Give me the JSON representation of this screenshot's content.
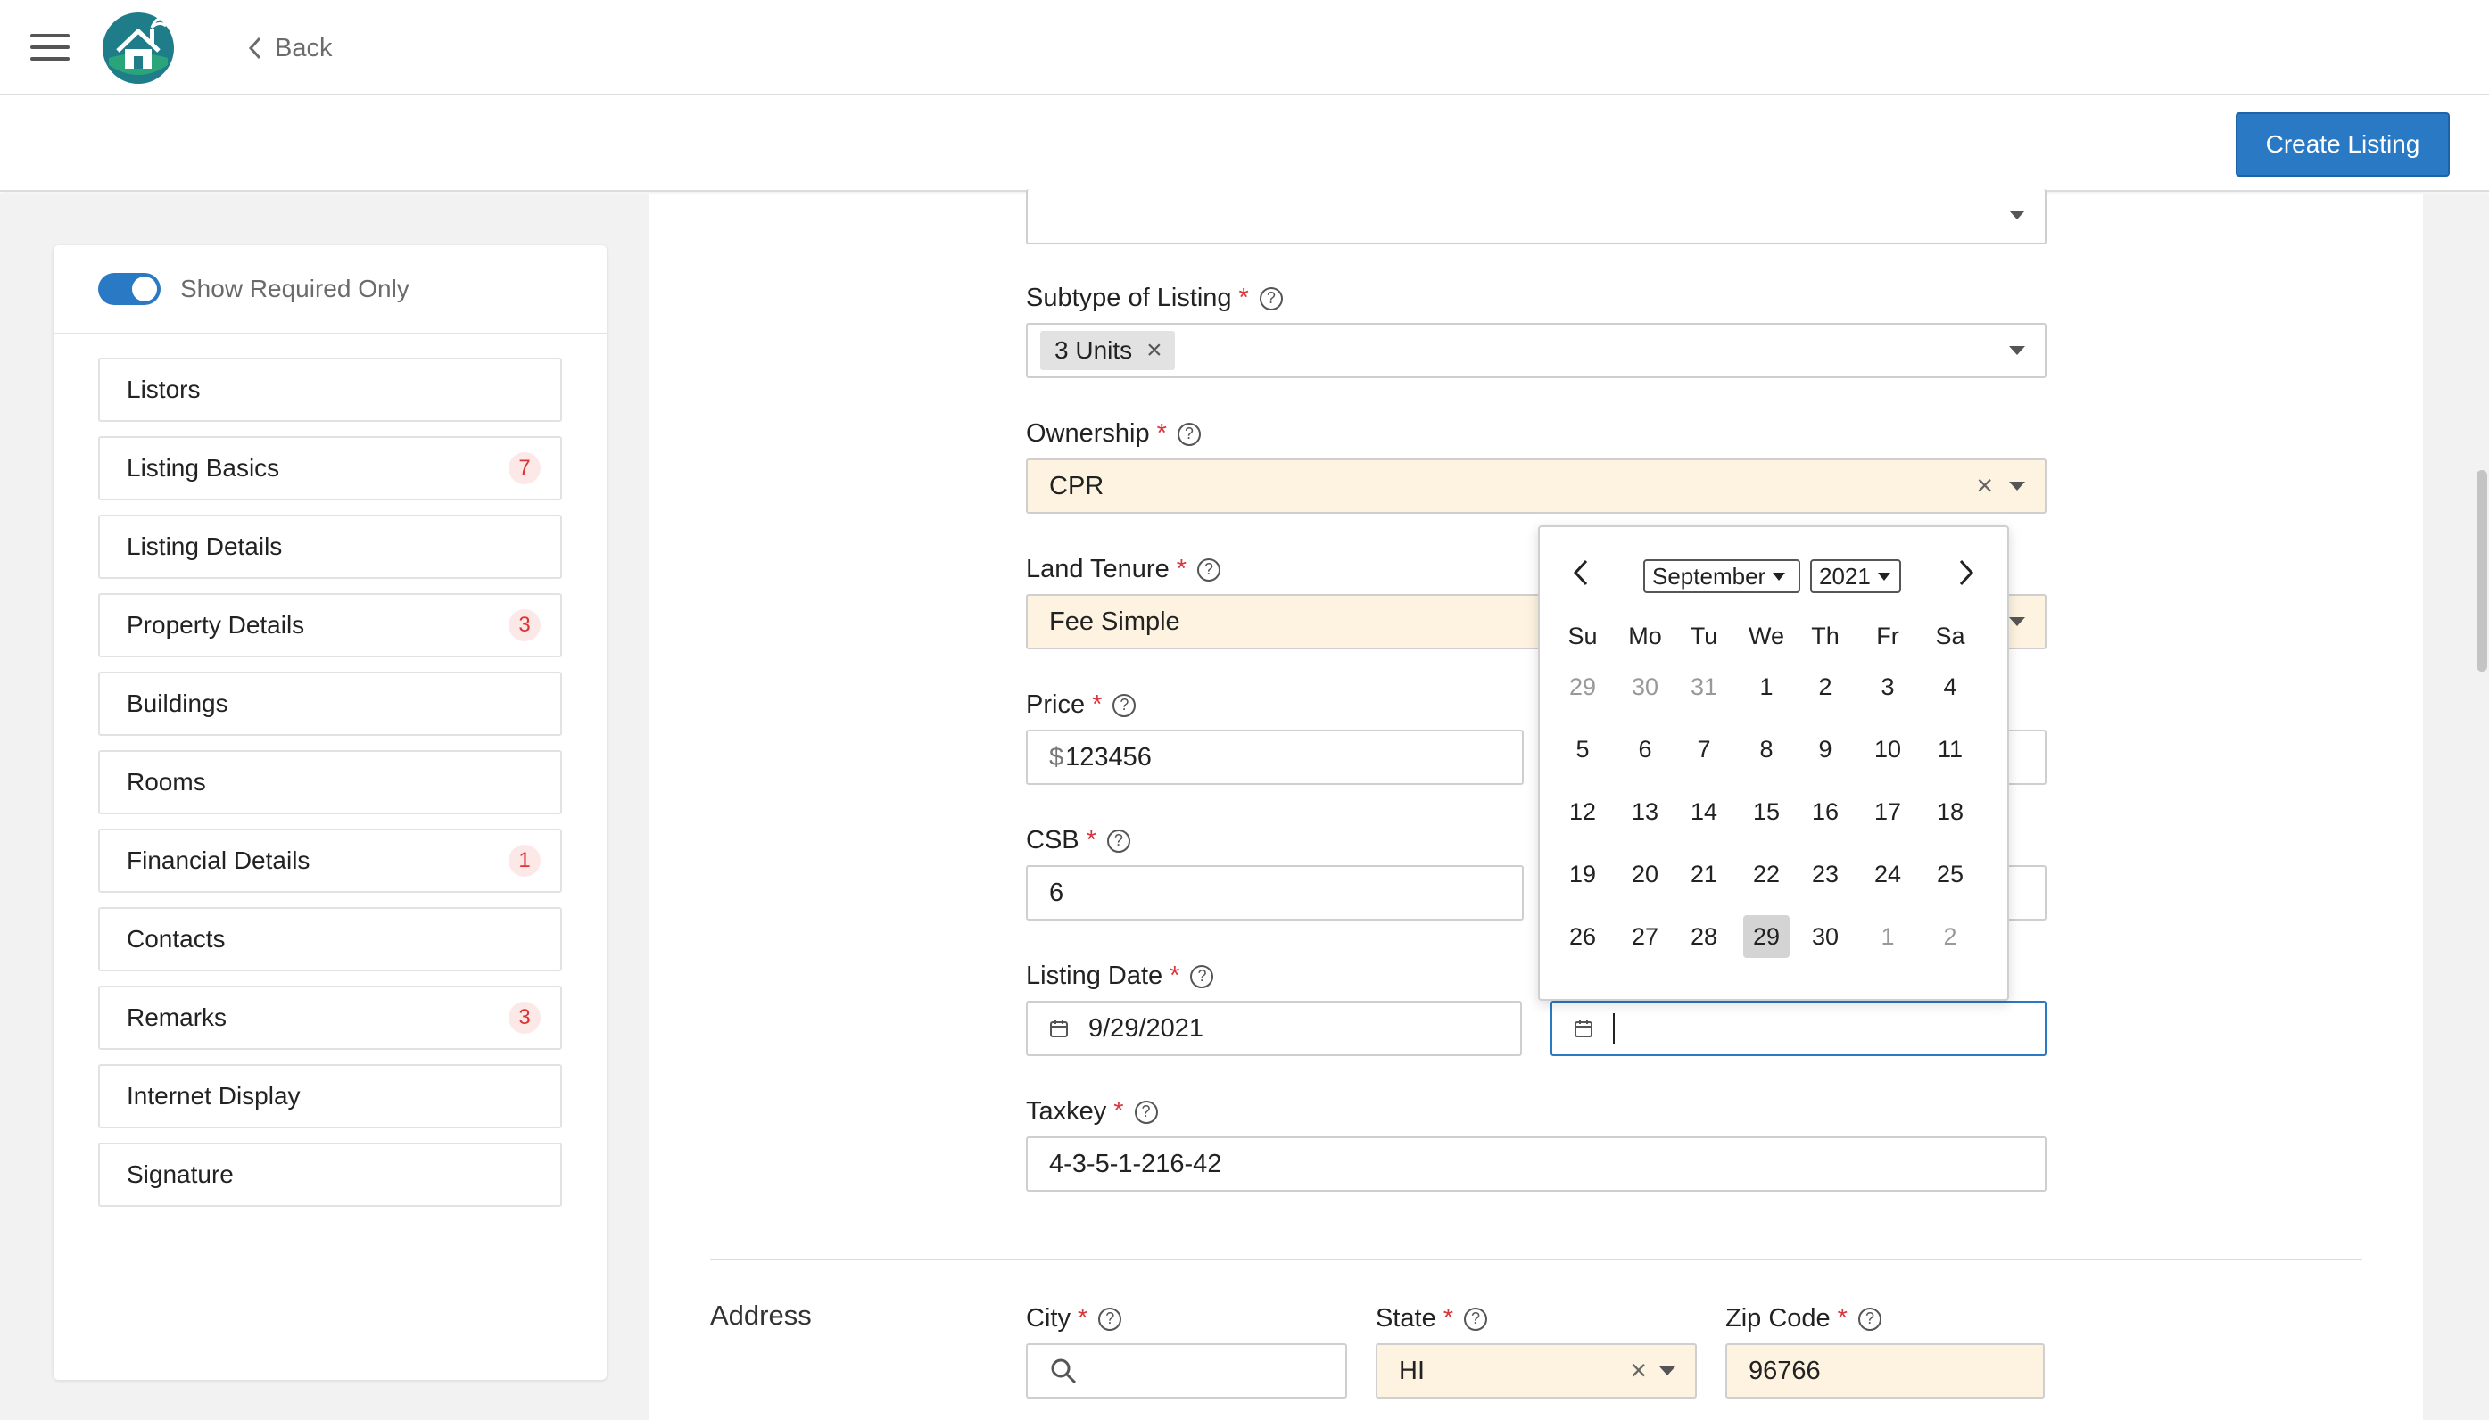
{
  "header": {
    "back_label": "Back"
  },
  "actionbar": {
    "create_label": "Create Listing"
  },
  "sidebar": {
    "toggle_label": "Show Required Only",
    "items": [
      {
        "label": "Listors",
        "badge": ""
      },
      {
        "label": "Listing Basics",
        "badge": "7"
      },
      {
        "label": "Listing Details",
        "badge": ""
      },
      {
        "label": "Property Details",
        "badge": "3"
      },
      {
        "label": "Buildings",
        "badge": ""
      },
      {
        "label": "Rooms",
        "badge": ""
      },
      {
        "label": "Financial Details",
        "badge": "1"
      },
      {
        "label": "Contacts",
        "badge": ""
      },
      {
        "label": "Remarks",
        "badge": "3"
      },
      {
        "label": "Internet Display",
        "badge": ""
      },
      {
        "label": "Signature",
        "badge": ""
      }
    ]
  },
  "form": {
    "subtype": {
      "label": "Subtype of Listing",
      "chip": "3 Units"
    },
    "ownership": {
      "label": "Ownership",
      "value": "CPR"
    },
    "land_tenure": {
      "label": "Land Tenure",
      "value": "Fee Simple"
    },
    "price": {
      "label": "Price",
      "currency": "$",
      "value": "123456"
    },
    "csb": {
      "label": "CSB",
      "value": "6"
    },
    "listing_date": {
      "label": "Listing Date",
      "value": "9/29/2021"
    },
    "taxkey": {
      "label": "Taxkey",
      "value": "4-3-5-1-216-42"
    },
    "address": {
      "section_title": "Address",
      "city": {
        "label": "City",
        "value": ""
      },
      "state": {
        "label": "State",
        "value": "HI"
      },
      "zip": {
        "label": "Zip Code",
        "value": "96766"
      }
    },
    "required_mark": "*",
    "help_glyph": "?"
  },
  "calendar": {
    "month": "September",
    "year": "2021",
    "weekdays": [
      "Su",
      "Mo",
      "Tu",
      "We",
      "Th",
      "Fr",
      "Sa"
    ],
    "weeks": [
      [
        "29",
        "30",
        "31",
        "1",
        "2",
        "3",
        "4"
      ],
      [
        "5",
        "6",
        "7",
        "8",
        "9",
        "10",
        "11"
      ],
      [
        "12",
        "13",
        "14",
        "15",
        "16",
        "17",
        "18"
      ],
      [
        "19",
        "20",
        "21",
        "22",
        "23",
        "24",
        "25"
      ],
      [
        "26",
        "27",
        "28",
        "29",
        "30",
        "1",
        "2"
      ]
    ],
    "muted": [
      "0-0",
      "0-1",
      "0-2",
      "4-5",
      "4-6"
    ],
    "selected": "4-3"
  },
  "colors": {
    "accent": "#2a79c4",
    "required": "#d9363e",
    "filled_bg": "#fdf3e0",
    "badge_bg": "#fde8e8"
  },
  "icons": [
    "hamburger-icon",
    "logo-house-icon",
    "chevron-left-icon",
    "chevron-down-icon",
    "close-icon",
    "help-icon",
    "calendar-icon",
    "search-icon",
    "chevron-right-icon"
  ]
}
